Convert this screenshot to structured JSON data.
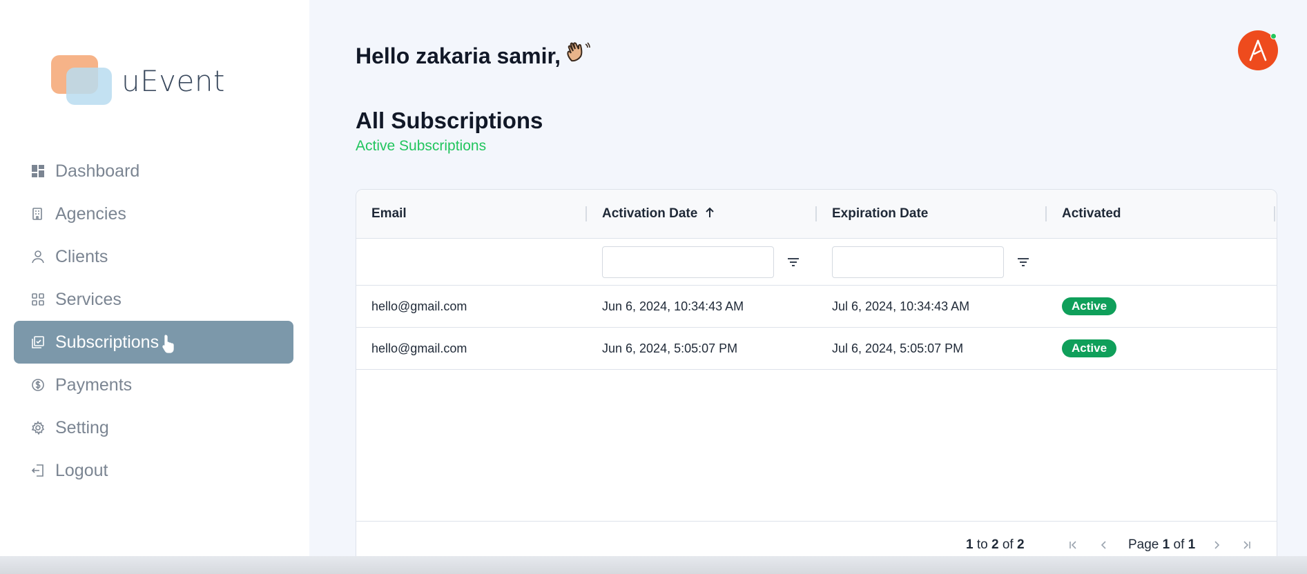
{
  "app": {
    "name": "uEvent"
  },
  "sidebar": {
    "items": [
      {
        "label": "Dashboard",
        "icon": "dashboard-icon",
        "active": false
      },
      {
        "label": "Agencies",
        "icon": "agencies-icon",
        "active": false
      },
      {
        "label": "Clients",
        "icon": "user-icon",
        "active": false
      },
      {
        "label": "Services",
        "icon": "services-icon",
        "active": false
      },
      {
        "label": "Subscriptions",
        "icon": "subscriptions-icon",
        "active": true
      },
      {
        "label": "Payments",
        "icon": "dollar-icon",
        "active": false
      },
      {
        "label": "Setting",
        "icon": "gear-icon",
        "active": false
      },
      {
        "label": "Logout",
        "icon": "logout-icon",
        "active": false
      }
    ]
  },
  "header": {
    "greeting": "Hello zakaria samir,",
    "avatar_initial": "Λ"
  },
  "page": {
    "title": "All Subscriptions",
    "subtitle": "Active Subscriptions"
  },
  "table": {
    "columns": [
      "Email",
      "Activation Date",
      "Expiration Date",
      "Activated"
    ],
    "sorted_column": "Activation Date",
    "sort_direction": "ascending",
    "rows": [
      {
        "email": "hello@gmail.com",
        "activation": "Jun 6, 2024, 10:34:43 AM",
        "expiration": "Jul 6, 2024, 10:34:43 AM",
        "status": "Active"
      },
      {
        "email": "hello@gmail.com",
        "activation": "Jun 6, 2024, 5:05:07 PM",
        "expiration": "Jul 6, 2024, 5:05:07 PM",
        "status": "Active"
      }
    ],
    "footer": {
      "from": "1",
      "to_word": "to",
      "to": "2",
      "of_word": "of",
      "total": "2",
      "page_word": "Page",
      "page": "1",
      "page_of_word": "of",
      "page_total": "1"
    }
  },
  "colors": {
    "accent_active_nav": "#7c98aa",
    "subtitle_green": "#22c55e",
    "badge_green": "#0f9f5a",
    "avatar_orange": "#ee4b1d"
  }
}
